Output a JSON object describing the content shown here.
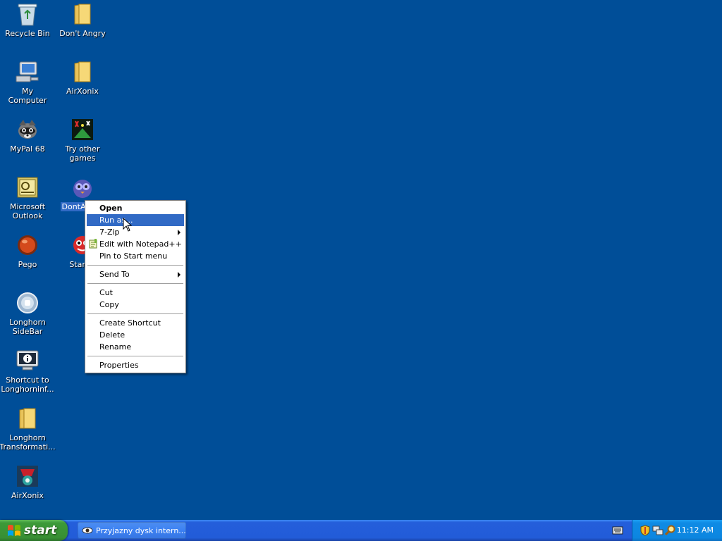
{
  "desktop_icons": [
    {
      "label": "Recycle Bin",
      "icon": "recycle-bin-icon"
    },
    {
      "label": "Don't Angry",
      "icon": "folder-icon"
    },
    {
      "label": "My Computer",
      "icon": "my-computer-icon"
    },
    {
      "label": "AirXonix",
      "icon": "folder-icon"
    },
    {
      "label": "MyPal 68",
      "icon": "mypal-icon"
    },
    {
      "label": "Try other\ngames",
      "icon": "games-icon"
    },
    {
      "label": "Microsoft\nOutlook",
      "icon": "outlook-icon"
    },
    {
      "label": "DontAngry",
      "icon": "owl-icon"
    },
    {
      "label": "Pego",
      "icon": "pego-icon"
    },
    {
      "label": "Start...",
      "icon": "start-game-icon"
    },
    {
      "label": "Longhorn\nSideBar",
      "icon": "sidebar-icon"
    },
    {
      "label": "Shortcut to\nLonghorninf...",
      "icon": "info-shortcut-icon"
    },
    {
      "label": "Longhorn\nTransformati...",
      "icon": "folder-icon"
    },
    {
      "label": "AirXonix",
      "icon": "airxonix-icon"
    }
  ],
  "context_menu": {
    "open": "Open",
    "run_as": "Run as...",
    "seven_zip": "7-Zip",
    "edit_notepad": "Edit with Notepad++",
    "pin_start": "Pin to Start menu",
    "send_to": "Send To",
    "cut": "Cut",
    "copy": "Copy",
    "create_shortcut": "Create Shortcut",
    "delete": "Delete",
    "rename": "Rename",
    "properties": "Properties"
  },
  "taskbar": {
    "start_label": "start",
    "task_label": "Przyjazny dysk intern...",
    "clock": "11:12 AM"
  },
  "colors": {
    "desktop": "#004e98",
    "highlight": "#316ac5",
    "taskbar": "#245edb",
    "start": "#3c9a38",
    "tray": "#0f8be5"
  }
}
